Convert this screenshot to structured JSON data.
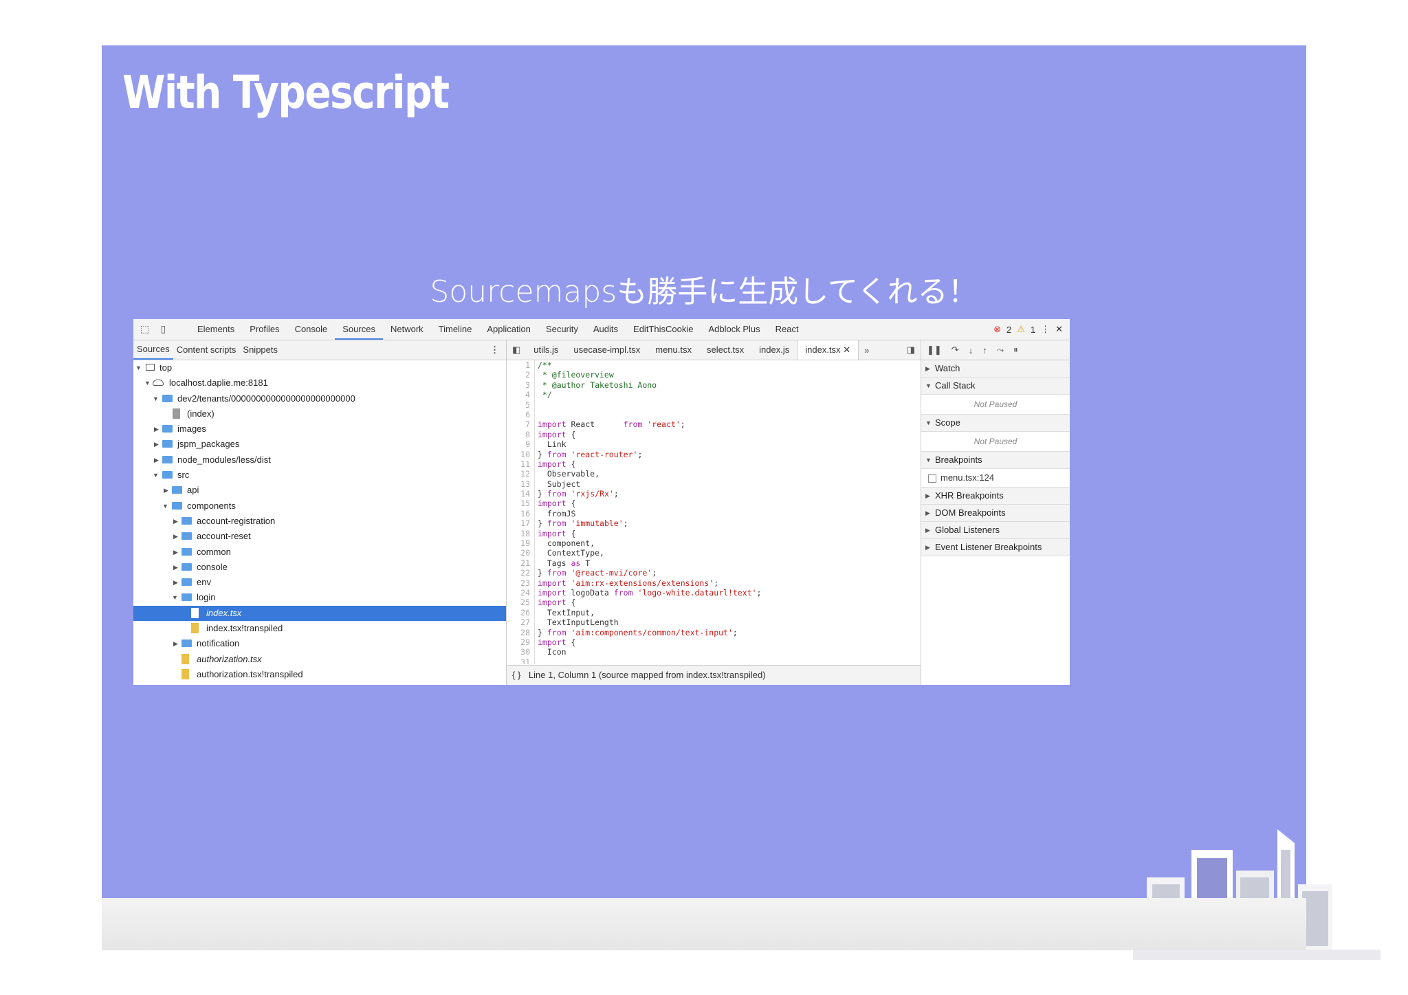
{
  "slide": {
    "title": "With Typescript",
    "subtitle": "Sourcemapsも勝手に生成してくれる！"
  },
  "devtools": {
    "main_tabs": [
      "Elements",
      "Profiles",
      "Console",
      "Sources",
      "Network",
      "Timeline",
      "Application",
      "Security",
      "Audits",
      "EditThisCookie",
      "Adblock Plus",
      "React"
    ],
    "active_tab": "Sources",
    "error_count": "2",
    "warning_count": "1",
    "nav_tabs": [
      "Sources",
      "Content scripts",
      "Snippets"
    ],
    "tree": {
      "top": "top",
      "host": "localhost.daplie.me:8181",
      "tenant": "dev2/tenants/0000000000000000000000000",
      "index": "(index)",
      "images": "images",
      "jspm": "jspm_packages",
      "node_modules": "node_modules/less/dist",
      "src": "src",
      "api": "api",
      "components": "components",
      "account_registration": "account-registration",
      "account_reset": "account-reset",
      "common": "common",
      "console": "console",
      "env": "env",
      "login": "login",
      "index_tsx": "index.tsx",
      "index_transpiled": "index.tsx!transpiled",
      "notification": "notification",
      "authorization": "authorization.tsx",
      "authorization_transpiled": "authorization.tsx!transpiled"
    },
    "file_tabs": [
      "utils.js",
      "usecase-impl.tsx",
      "menu.tsx",
      "select.tsx",
      "index.js",
      "index.tsx"
    ],
    "active_file": "index.tsx",
    "code_lines": [
      "/**",
      " * @fileoverview",
      " * @author Taketoshi Aono",
      " */",
      "",
      "",
      "import React      from 'react';",
      "import {",
      "  Link",
      "} from 'react-router';",
      "import {",
      "  Observable,",
      "  Subject",
      "} from 'rxjs/Rx';",
      "import {",
      "  fromJS",
      "} from 'immutable';",
      "import {",
      "  component,",
      "  ContextType,",
      "  Tags as T",
      "} from '@react-mvi/core';",
      "import 'aim:rx-extensions/extensions';",
      "import logoData from 'logo-white.dataurl!text';",
      "import {",
      "  TextInput,",
      "  TextInputLength",
      "} from 'aim:components/common/text-input';",
      "import {",
      "  Icon",
      ""
    ],
    "status_text": "Line 1, Column 1   (source mapped from index.tsx!transpiled)",
    "status_icon": "{ }",
    "debugger": {
      "watch": "Watch",
      "call_stack": "Call Stack",
      "not_paused_1": "Not Paused",
      "scope": "Scope",
      "not_paused_2": "Not Paused",
      "breakpoints": "Breakpoints",
      "breakpoint_item": "menu.tsx:124",
      "xhr": "XHR Breakpoints",
      "dom": "DOM Breakpoints",
      "global": "Global Listeners",
      "event": "Event Listener Breakpoints"
    }
  },
  "colors": {
    "slide_bg": "#949bed",
    "selection": "#3879d9",
    "tab_accent": "#4a86e8"
  }
}
